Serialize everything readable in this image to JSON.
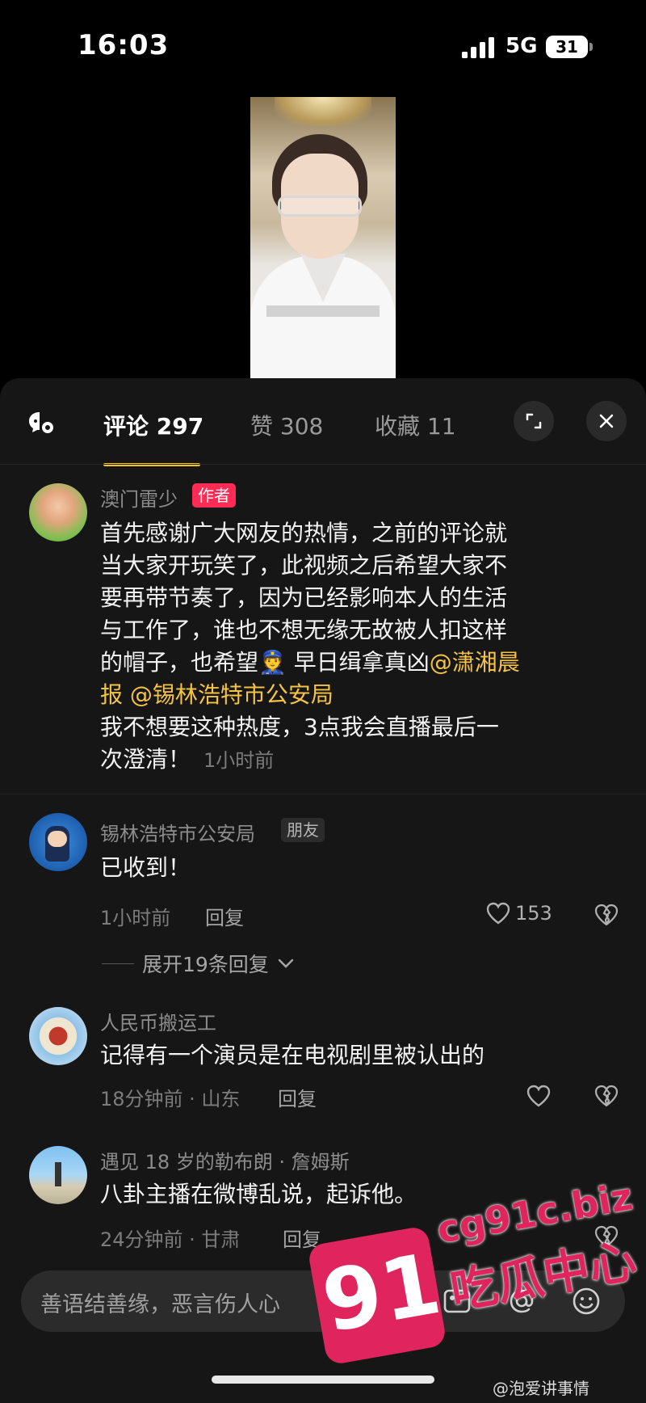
{
  "status_bar": {
    "time": "16:03",
    "network": "5G",
    "battery": "31"
  },
  "video": {
    "subtitle_text": ""
  },
  "tabs": [
    {
      "label": "评论 297"
    },
    {
      "label": "赞 308"
    },
    {
      "label": "收藏 11"
    }
  ],
  "comments": [
    {
      "username": "澳门雷少",
      "badge": "作者",
      "text_lines": [
        "首先感谢广大网友的热情，之前的评论就",
        "当大家开玩笑了，此视频之后希望大家不",
        "要再带节奏了，因为已经影响本人的生活",
        "与工作了，谁也不想无缘无故被人扣这样",
        "的帽子，也希望"
      ],
      "emoji": "👮",
      "text_after_emoji": " 早日缉拿真凶",
      "mention_1": "@潇湘晨",
      "mention_2": "报 @锡林浩特市公安局",
      "text_tail_1": "我不想要这种热度，3点我会直播最后一",
      "text_tail_2": "次澄清！",
      "time": "1小时前"
    },
    {
      "username": "锡林浩特市公安局",
      "badge": "朋友",
      "text": "已收到！",
      "time": "1小时前",
      "reply_label": "回复",
      "likes": "153"
    },
    {
      "username": "人民币搬运工",
      "text": "记得有一个演员是在电视剧里被认出的",
      "meta": "18分钟前 · 山东",
      "reply_label": "回复"
    },
    {
      "username": "遇见 18 岁的勒布朗 · 詹姆斯",
      "text": "八卦主播在微博乱说，起诉他。",
      "meta": "24分钟前 · 甘肃",
      "reply_label": "回复"
    }
  ],
  "expand_replies": "展开19条回复",
  "input": {
    "placeholder": "善语结善缘，恶言伤人心"
  },
  "watermark": {
    "number": "91",
    "site": "cg91c.biz",
    "name": "吃瓜中心"
  },
  "footer_credit": "@泡爱讲事情",
  "colors": {
    "accent_underline": "#f7c512",
    "mention": "#f6c343",
    "author_badge": "#fe2c55",
    "watermark": "#e0245e"
  }
}
